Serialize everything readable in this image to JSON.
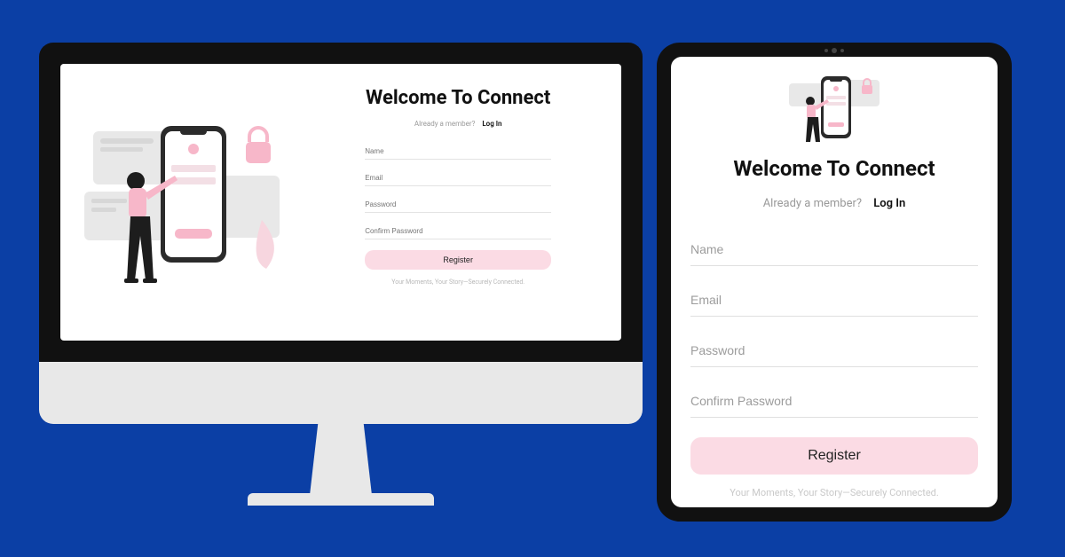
{
  "heading": "Welcome To Connect",
  "member_prompt": "Already a member?",
  "login_link": "Log In",
  "fields": {
    "name": "Name",
    "email": "Email",
    "password": "Password",
    "confirm": "Confirm Password"
  },
  "register_button": "Register",
  "tagline": "Your Moments, Your Story—Securely Connected.",
  "colors": {
    "background": "#0b3fa5",
    "button": "#fbdbe4",
    "text_muted": "#9a9a9a"
  }
}
